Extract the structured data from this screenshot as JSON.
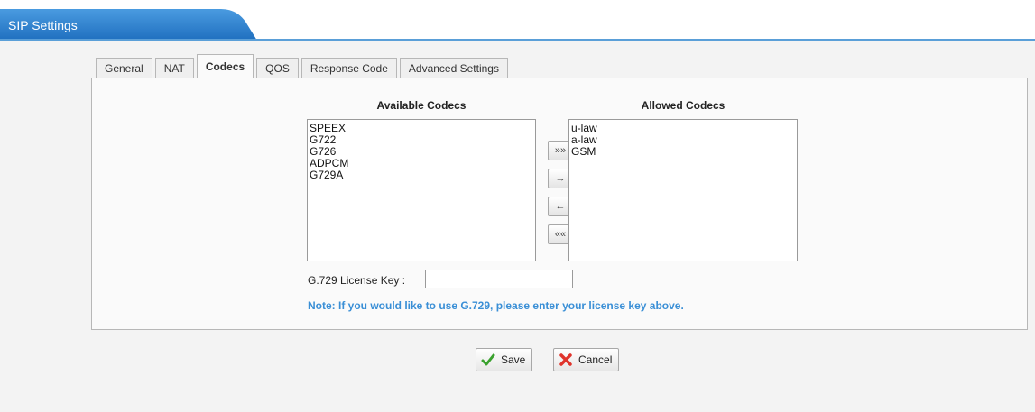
{
  "header": {
    "title": "SIP Settings"
  },
  "tabs": [
    {
      "label": "General",
      "active": false
    },
    {
      "label": "NAT",
      "active": false
    },
    {
      "label": "Codecs",
      "active": true
    },
    {
      "label": "QOS",
      "active": false
    },
    {
      "label": "Response Code",
      "active": false
    },
    {
      "label": "Advanced Settings",
      "active": false
    }
  ],
  "codecs": {
    "available_title": "Available Codecs",
    "allowed_title": "Allowed Codecs",
    "available": [
      "SPEEX",
      "G722",
      "G726",
      "ADPCM",
      "G729A"
    ],
    "allowed": [
      "u-law",
      "a-law",
      "GSM"
    ],
    "move_buttons": [
      {
        "label": "»»",
        "icon": "move-all-right-icon"
      },
      {
        "label": "→",
        "icon": "move-right-icon"
      },
      {
        "label": "←",
        "icon": "move-left-icon"
      },
      {
        "label": "««",
        "icon": "move-all-left-icon"
      }
    ]
  },
  "license": {
    "label": "G.729 License Key :",
    "value": "",
    "note": "Note: If you would like to use G.729, please enter your license key above."
  },
  "actions": {
    "save_label": "Save",
    "cancel_label": "Cancel",
    "save_icon": "checkmark-icon",
    "cancel_icon": "x-icon"
  },
  "colors": {
    "header_blue": "#2f80c9",
    "note_blue": "#3a8fd6",
    "save_green": "#3aa12e",
    "cancel_red": "#e0342c"
  }
}
